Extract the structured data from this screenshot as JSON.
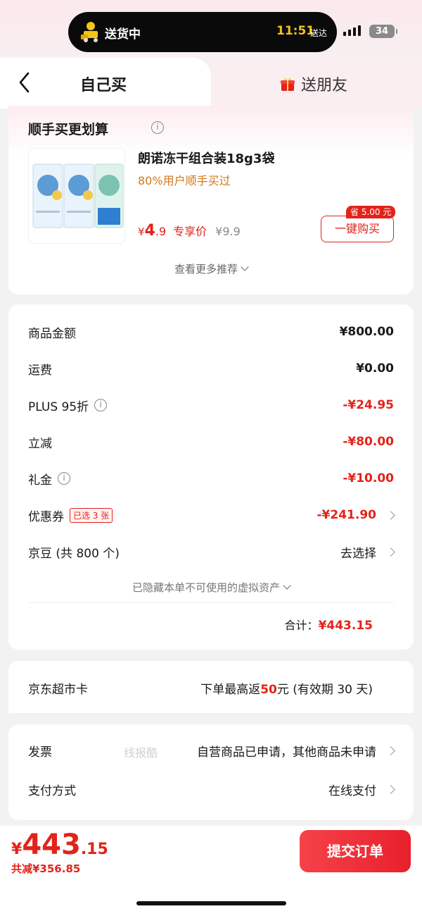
{
  "status_bar": {
    "delivery_text": "送货中",
    "time": "11:51",
    "time_suffix": "送达",
    "battery": "34"
  },
  "tabs": {
    "self_label": "自己买",
    "gift_label": "送朋友"
  },
  "recommendation": {
    "title": "顺手买更划算",
    "product_name": "朗诺冻干组合装18g3袋",
    "product_sub": "80%用户顺手买过",
    "price_yen": "¥",
    "price_int": "4",
    "price_dec": ".9",
    "price_tag": "专享价",
    "price_orig": "¥9.9",
    "save_badge": "省 5.00 元",
    "buy_label": "一键购买",
    "more_label": "查看更多推荐"
  },
  "price_details": {
    "rows": [
      {
        "label": "商品金额",
        "value": "¥800.00"
      },
      {
        "label": "运费",
        "value": "¥0.00"
      },
      {
        "label": "PLUS 95折",
        "value": "-¥24.95"
      },
      {
        "label": "立减",
        "value": "-¥80.00"
      },
      {
        "label": "礼金",
        "value": "-¥10.00"
      },
      {
        "label": "优惠券",
        "value": "-¥241.90",
        "badge": "已选 3 张"
      },
      {
        "label": "京豆 (共 800 个)",
        "value": "去选择"
      }
    ],
    "hidden_assets": "已隐藏本单不可使用的虚拟资产",
    "total_label": "合计：",
    "total_value": "¥443.15"
  },
  "supermarket_card": {
    "label": "京东超市卡",
    "value_prefix": "下单最高返",
    "value_highlight": "50",
    "value_suffix": "元 (有效期 30 天)"
  },
  "invoice": {
    "label": "发票",
    "value": "自营商品已申请，其他商品未申请"
  },
  "payment": {
    "label": "支付方式",
    "value": "在线支付"
  },
  "watermark": "线报酷",
  "bottom": {
    "yen": "¥",
    "int": "443",
    "dec": ".15",
    "saved": "共减¥356.85",
    "submit_label": "提交订单"
  },
  "colors": {
    "accent_red": "#e2231a",
    "price_orange": "#d07a1a",
    "island_time": "#f1c21b"
  }
}
